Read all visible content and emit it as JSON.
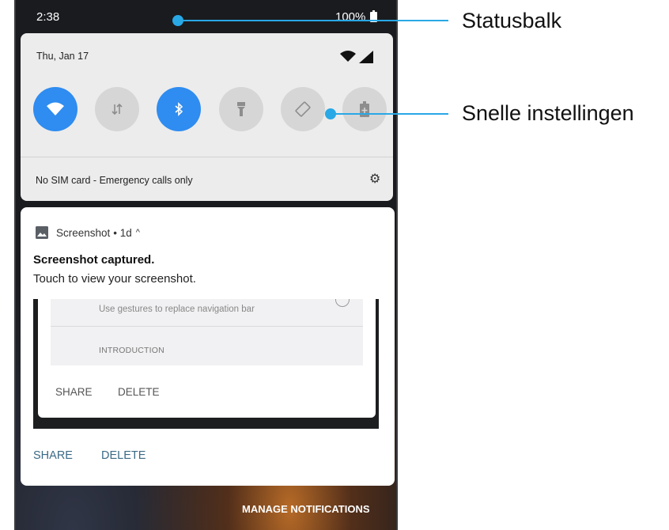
{
  "status_bar": {
    "time": "2:38",
    "battery": "100%"
  },
  "quick_settings": {
    "date": "Thu, Jan 17",
    "tiles": [
      {
        "name": "wifi",
        "icon": "wifi-icon",
        "active": true
      },
      {
        "name": "mobile-data",
        "icon": "data-arrows-icon",
        "active": false
      },
      {
        "name": "bluetooth",
        "icon": "bluetooth-icon",
        "active": true
      },
      {
        "name": "flashlight",
        "icon": "flashlight-icon",
        "active": false
      },
      {
        "name": "auto-rotate",
        "icon": "rotate-icon",
        "active": false
      },
      {
        "name": "battery-saver",
        "icon": "battery-icon",
        "active": false
      }
    ],
    "sim_status": "No SIM card - Emergency calls only"
  },
  "notification": {
    "app": "Screenshot",
    "time": "• 1d",
    "title": "Screenshot captured.",
    "text": "Touch to view your screenshot.",
    "preview": {
      "gesture_text": "Use gestures to replace navigation bar",
      "intro_text": "INTRODUCTION",
      "share": "SHARE",
      "delete": "DELETE"
    },
    "actions": {
      "share": "SHARE",
      "delete": "DELETE"
    }
  },
  "manage_notifications": "MANAGE NOTIFICATIONS",
  "callouts": {
    "status_bar": "Statusbalk",
    "quick_settings": "Snelle instellingen"
  },
  "colors": {
    "accent": "#2f8cf0",
    "callout": "#29a8e6",
    "action_text": "#3b6a86"
  }
}
